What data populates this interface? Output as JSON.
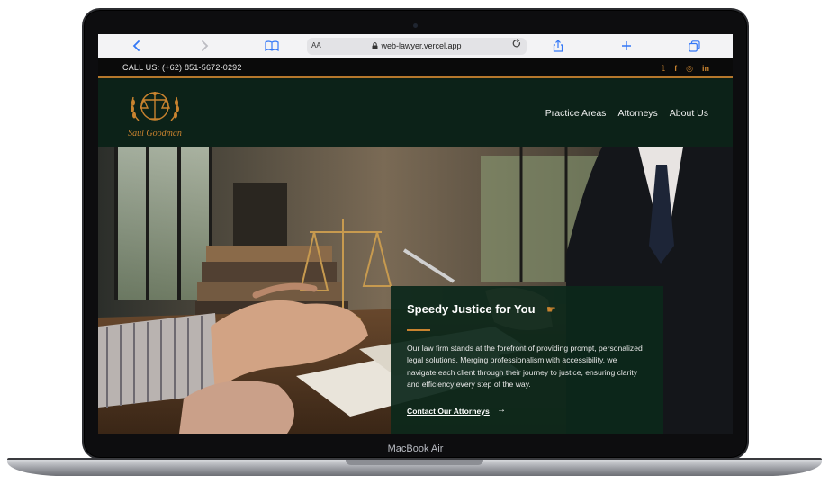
{
  "device": {
    "model_label": "MacBook Air"
  },
  "browser": {
    "text_size_label": "AA",
    "url": "web-lawyer.vercel.app",
    "icons": [
      "back-icon",
      "forward-icon",
      "reader-icon",
      "lock-icon",
      "reload-icon",
      "share-icon",
      "new-tab-icon",
      "tabs-icon"
    ]
  },
  "site": {
    "call_text": "CALL US: (+62) 851-5672-0292",
    "social": [
      {
        "icon": "twitter-icon",
        "glyph": "𝕥"
      },
      {
        "icon": "facebook-icon",
        "glyph": "f"
      },
      {
        "icon": "instagram-icon",
        "glyph": "◎"
      },
      {
        "icon": "linkedin-icon",
        "glyph": "in"
      }
    ],
    "logo_text": "Saul Goodman",
    "nav": [
      "Practice Areas",
      "Attorneys",
      "About Us"
    ],
    "hero": {
      "title": "Speedy Justice for You",
      "title_icon": "hand-pointing-icon",
      "body": "Our law firm stands at the forefront of providing prompt, personalized legal solutions. Merging professionalism with accessibility, we navigate each client through their journey to justice, ensuring clarity and efficiency every step of the way.",
      "link": "Contact Our Attorneys"
    },
    "colors": {
      "accent": "#c9832f",
      "dark_green": "#0c2218",
      "topbar": "#0a0a0a"
    }
  }
}
